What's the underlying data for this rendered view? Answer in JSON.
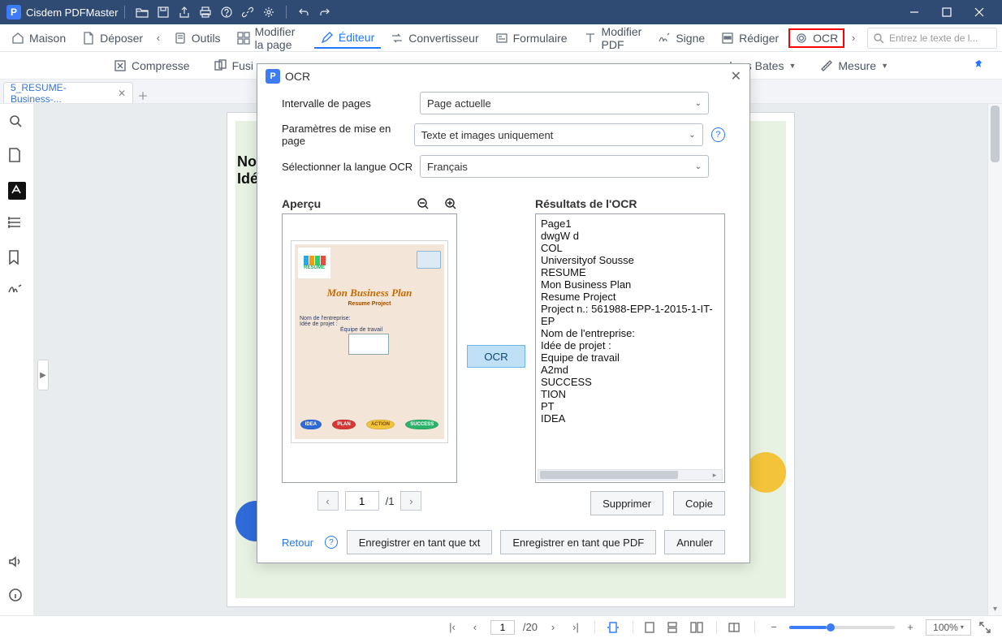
{
  "app": {
    "title": "Cisdem PDFMaster"
  },
  "window": {
    "min": "—",
    "max": "□",
    "close": "✕"
  },
  "mainTabs": {
    "home": "Maison",
    "file": "Déposer",
    "tools": "Outils",
    "editPage": "Modifier la page",
    "editor": "Éditeur",
    "converter": "Convertisseur",
    "form": "Formulaire",
    "editPdf": "Modifier PDF",
    "sign": "Signe",
    "redact": "Rédiger",
    "ocr": "OCR"
  },
  "search": {
    "placeholder": "Entrez le texte de l..."
  },
  "subbar": {
    "compress": "Compresse",
    "merge": "Fusi",
    "bates": "bres Bates",
    "measure": "Mesure"
  },
  "docTab": {
    "name": "5_RESUME-Business-..."
  },
  "page": {
    "line1": "Non",
    "line2": "Idée"
  },
  "dialog": {
    "title": "OCR",
    "labels": {
      "range": "Intervalle de pages",
      "layout": "Paramètres de mise en page",
      "lang": "Sélectionner la langue OCR"
    },
    "values": {
      "range": "Page actuelle",
      "layout": "Texte et images uniquement",
      "lang": "Français"
    },
    "preview": {
      "title": "Aperçu",
      "docTitle": "Mon Business Plan",
      "caption": "Resume Project",
      "line1": "Nom de l'entreprise:",
      "line2": "Idée de projet :",
      "line3": "Équipe de travail",
      "resumeLabel": "RESUME",
      "bubbles": [
        "IDEA",
        "PLAN",
        "ACTION",
        "SUCCESS"
      ],
      "page": "1",
      "total": "/1"
    },
    "runBtn": "OCR",
    "results": {
      "title": "Résultats de l'OCR",
      "lines": [
        "Page1",
        "dwgW d",
        "COL",
        "Universityof Sousse",
        "RESUME",
        "Mon Business Plan",
        "Resume Project",
        "Project n.: 561988-EPP-1-2015-1-IT-EP",
        "Nom de l'entreprise:",
        "Idée de projet :",
        "Equipe de travail",
        "A2md",
        "SUCCESS",
        "TION",
        "PT",
        "IDEA"
      ]
    },
    "btns": {
      "delete": "Supprimer",
      "copy": "Copie",
      "saveTxt": "Enregistrer en tant que txt",
      "savePdf": "Enregistrer en tant que PDF",
      "cancel": "Annuler",
      "back": "Retour"
    }
  },
  "bottom": {
    "page": "1",
    "total": "/20",
    "zoom": "100%"
  }
}
